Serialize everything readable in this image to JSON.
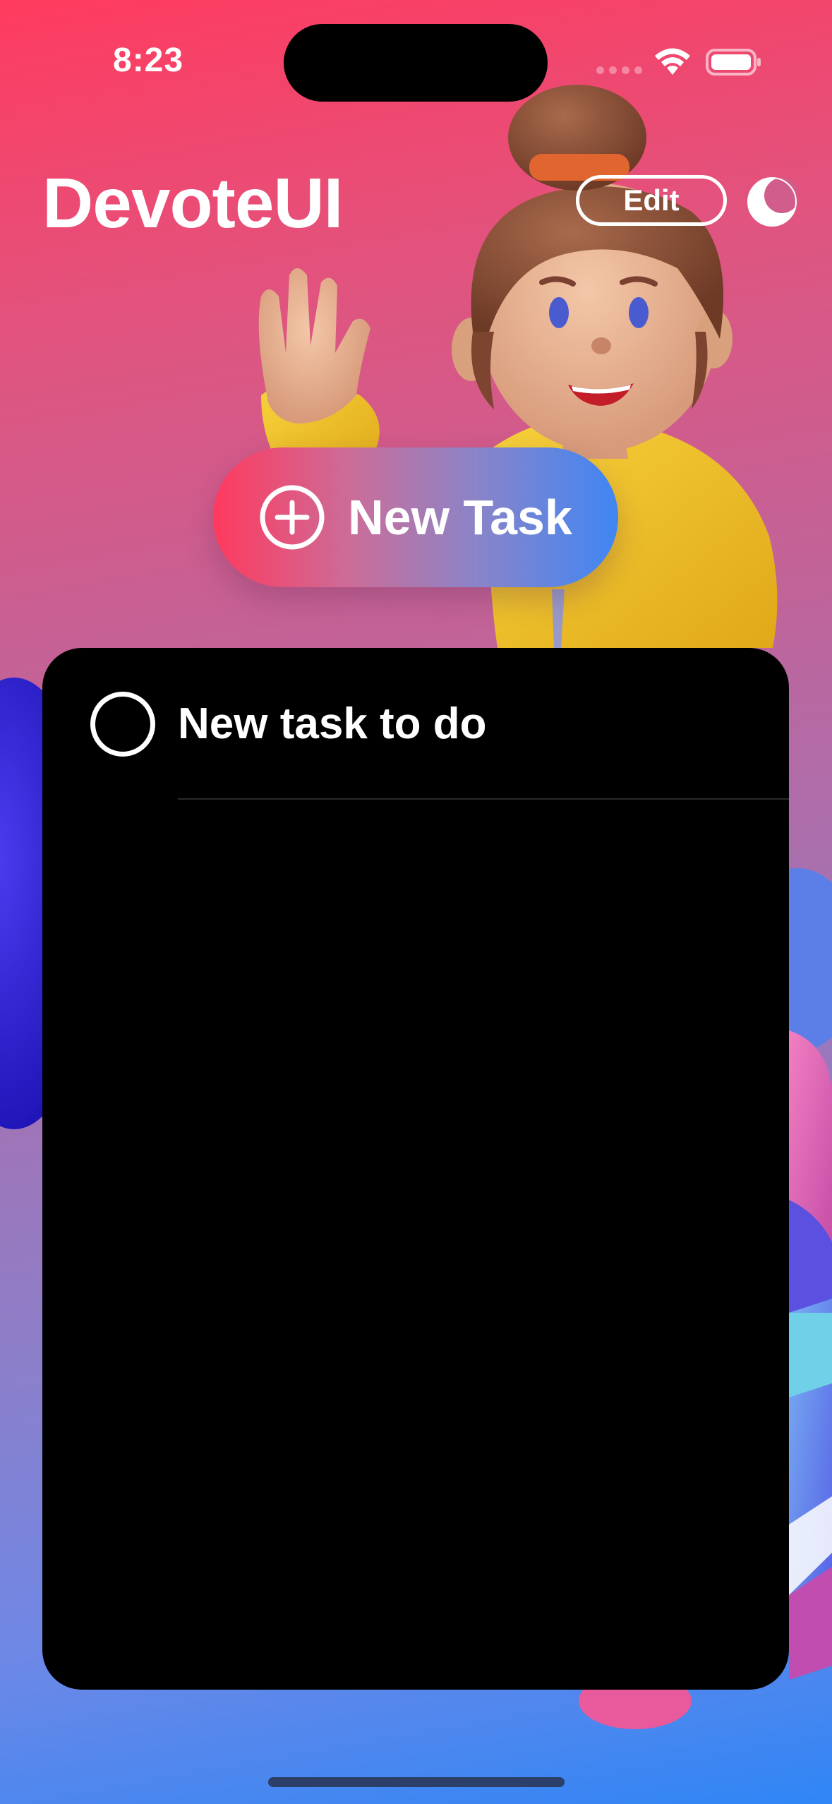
{
  "status_bar": {
    "time": "8:23",
    "icons": [
      "signal-dots-icon",
      "wifi-icon",
      "battery-icon"
    ]
  },
  "header": {
    "title": "DevoteUI",
    "edit_label": "Edit",
    "theme_toggle_icon": "moon-icon"
  },
  "actions": {
    "new_task_label": "New Task",
    "new_task_icon": "plus-circle-icon"
  },
  "tasks": [
    {
      "title": "New task to do",
      "completed": false
    }
  ],
  "colors": {
    "background_top": "#ff3b5f",
    "background_bottom": "#2f86f6",
    "button_gradient_start": "#ff3a5e",
    "button_gradient_end": "#3f86f4",
    "card": "#000000",
    "text": "#ffffff"
  }
}
